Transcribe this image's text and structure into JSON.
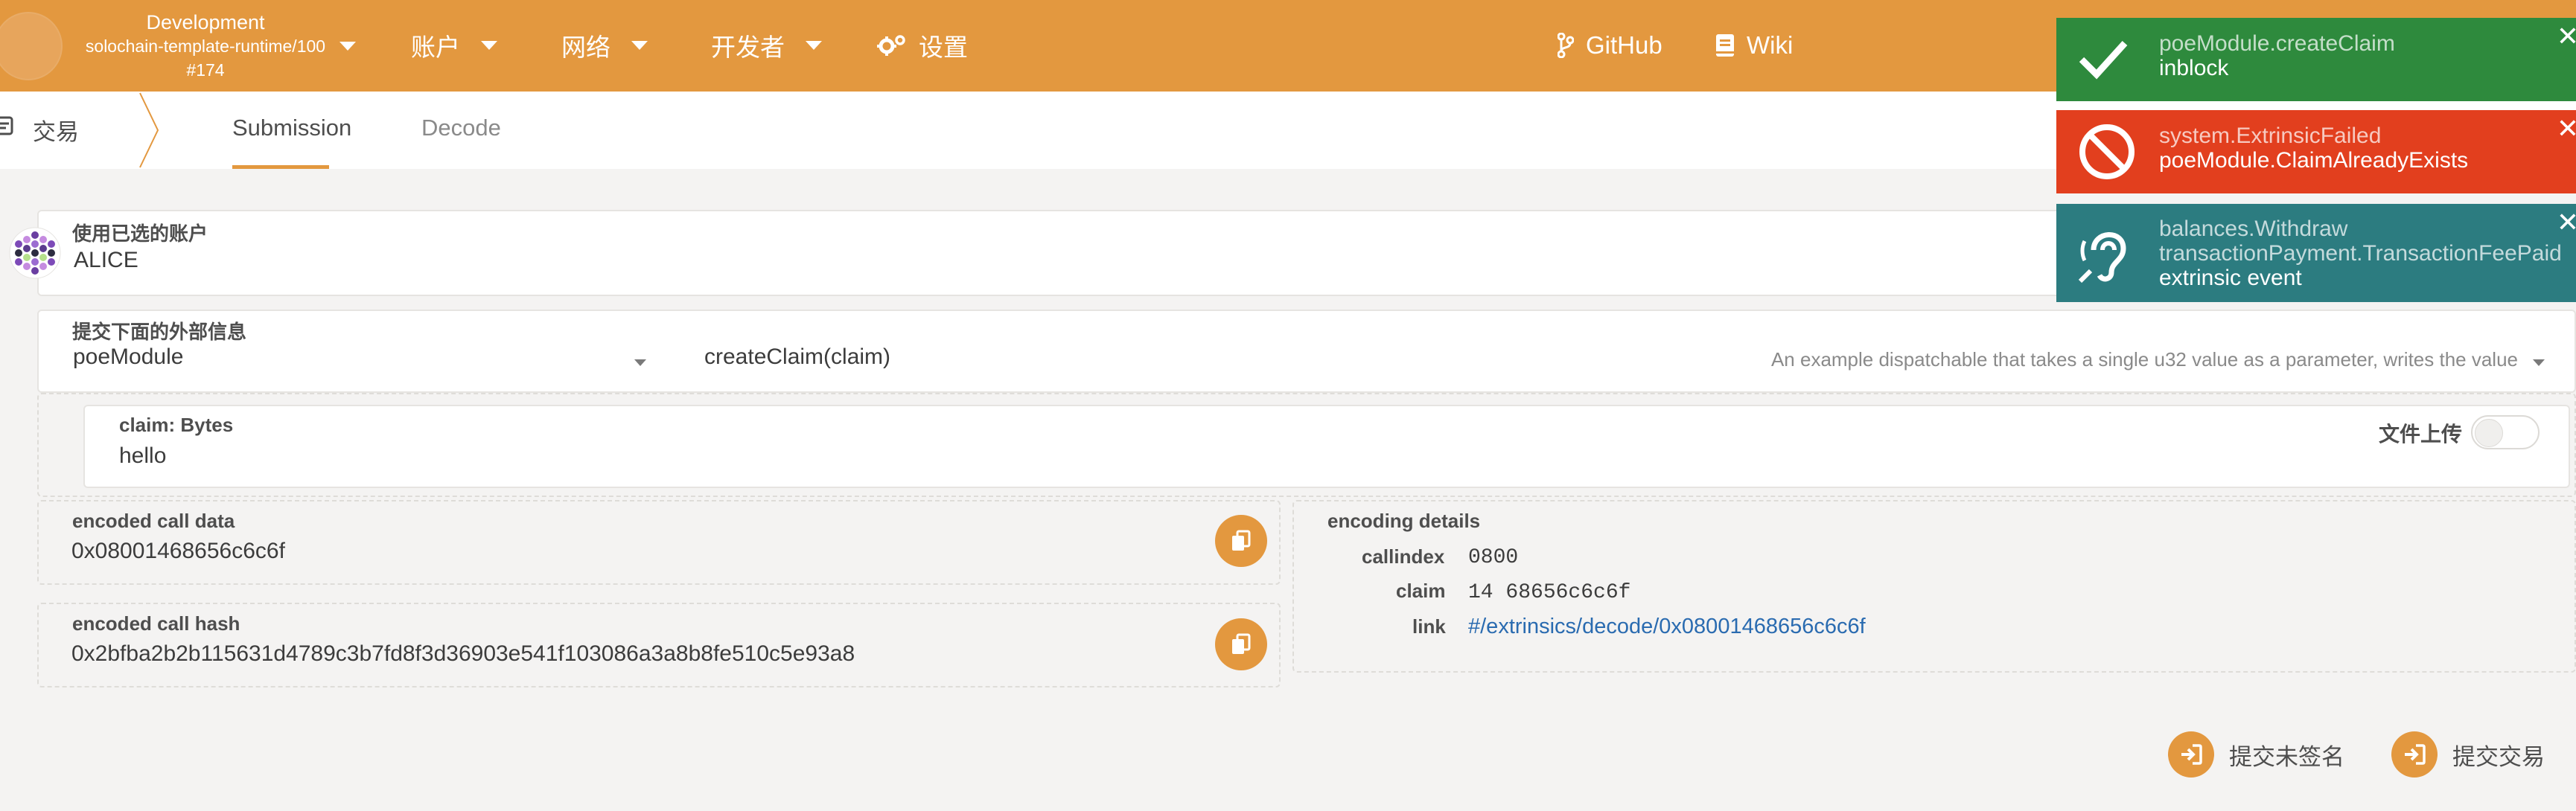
{
  "header": {
    "chain": {
      "name": "Development",
      "runtime": "solochain-template-runtime/100",
      "block": "#174"
    },
    "menu": [
      {
        "label": "账户"
      },
      {
        "label": "网络"
      },
      {
        "label": "开发者"
      },
      {
        "label": "设置"
      }
    ],
    "links": [
      {
        "label": "GitHub"
      },
      {
        "label": "Wiki"
      }
    ]
  },
  "subnav": {
    "section": "交易",
    "tabs": [
      {
        "label": "Submission",
        "active": true
      },
      {
        "label": "Decode",
        "active": false
      }
    ]
  },
  "account": {
    "label": "使用已选的账户",
    "name": "ALICE"
  },
  "extrinsic": {
    "label": "提交下面的外部信息",
    "module": "poeModule",
    "method": "createClaim(claim)",
    "description": "An example dispatchable that takes a single u32 value as a parameter, writes the value"
  },
  "param": {
    "label": "claim: Bytes",
    "value": "hello",
    "file_upload_label": "文件上传",
    "file_upload_on": false
  },
  "encoded": {
    "call_data_label": "encoded call data",
    "call_data": "0x08001468656c6c6f",
    "call_hash_label": "encoded call hash",
    "call_hash": "0x2bfba2b2b115631d4789c3b7fd8f3d36903e541f103086a3a8b8fe510c5e93a8"
  },
  "details": {
    "title": "encoding details",
    "callindex_label": "callindex",
    "callindex": "0800",
    "claim_label": "claim",
    "claim": "14 68656c6c6f",
    "link_label": "link",
    "link": "#/extrinsics/decode/0x08001468656c6c6f"
  },
  "actions": {
    "unsigned": "提交未签名",
    "submit": "提交交易"
  },
  "notifications": [
    {
      "status": "success",
      "color": "#2e8a3d",
      "lines": [
        "poeModule.createClaim",
        "inblock"
      ]
    },
    {
      "status": "error",
      "color": "#e23f1e",
      "lines": [
        "system.ExtrinsicFailed",
        "poeModule.ClaimAlreadyExists"
      ]
    },
    {
      "status": "event",
      "color": "#2c7c80",
      "lines": [
        "balances.Withdraw",
        "transactionPayment.TransactionFeePaid",
        "extrinsic event"
      ]
    }
  ],
  "colors": {
    "brand": "#e3983f",
    "background": "#f4f3f2",
    "link": "#2a6bb0"
  }
}
